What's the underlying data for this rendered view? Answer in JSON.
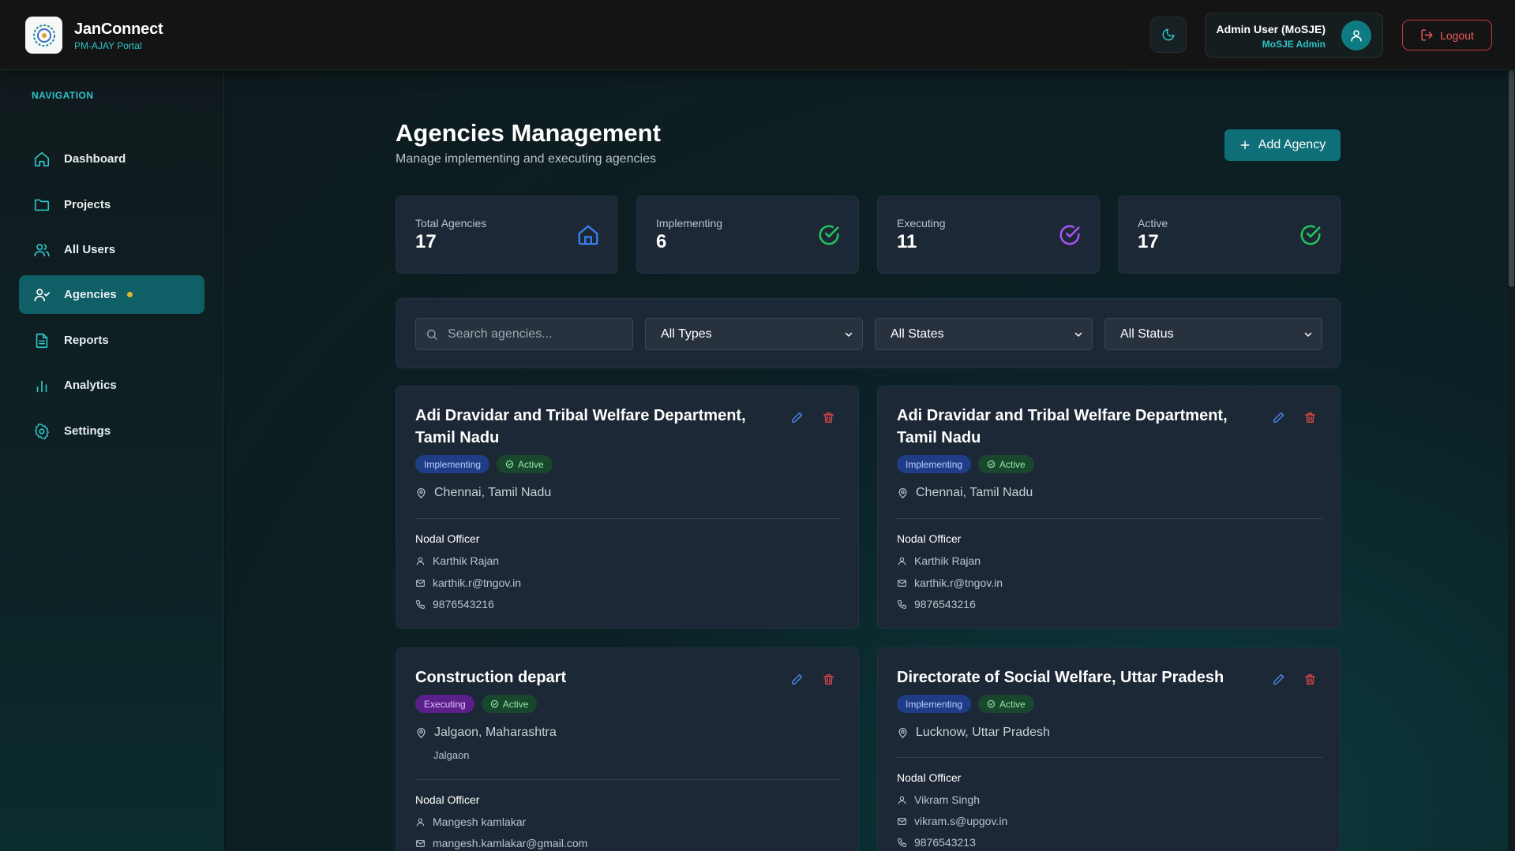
{
  "header": {
    "app_name": "JanConnect",
    "app_sub": "PM-AJAY Portal",
    "user_name": "Admin User (MoSJE)",
    "user_role": "MoSJE Admin",
    "logout_label": "Logout"
  },
  "sidebar": {
    "title": "NAVIGATION",
    "items": [
      {
        "label": "Dashboard",
        "icon": "home-icon"
      },
      {
        "label": "Projects",
        "icon": "folder-icon"
      },
      {
        "label": "All Users",
        "icon": "users-icon"
      },
      {
        "label": "Agencies",
        "icon": "user-check-icon",
        "active": true
      },
      {
        "label": "Reports",
        "icon": "file-text-icon"
      },
      {
        "label": "Analytics",
        "icon": "bar-chart-icon"
      },
      {
        "label": "Settings",
        "icon": "gear-icon"
      }
    ]
  },
  "main": {
    "title": "Agencies Management",
    "subtitle": "Manage implementing and executing agencies",
    "add_label": "Add Agency",
    "stats": [
      {
        "label": "Total Agencies",
        "value": "17",
        "color": "#3b82f6"
      },
      {
        "label": "Implementing",
        "value": "6",
        "color": "#22c55e"
      },
      {
        "label": "Executing",
        "value": "11",
        "color": "#a855f7"
      },
      {
        "label": "Active",
        "value": "17",
        "color": "#22c55e"
      }
    ],
    "filters": {
      "search_placeholder": "Search agencies...",
      "type": "All Types",
      "state": "All States",
      "status": "All Status"
    },
    "agencies": [
      {
        "name": "Adi Dravidar and Tribal Welfare Department, Tamil Nadu",
        "type": "Implementing",
        "status": "Active",
        "location": "Chennai, Tamil Nadu",
        "officer_label": "Nodal Officer",
        "officer_name": "Karthik Rajan",
        "officer_email": "karthik.r@tngov.in",
        "officer_phone": "9876543216"
      },
      {
        "name": "Adi Dravidar and Tribal Welfare Department, Tamil Nadu",
        "type": "Implementing",
        "status": "Active",
        "location": "Chennai, Tamil Nadu",
        "officer_label": "Nodal Officer",
        "officer_name": "Karthik Rajan",
        "officer_email": "karthik.r@tngov.in",
        "officer_phone": "9876543216"
      },
      {
        "name": "Construction depart",
        "type": "Executing",
        "status": "Active",
        "location": "Jalgaon, Maharashtra",
        "location_sub": "Jalgaon",
        "officer_label": "Nodal Officer",
        "officer_name": "Mangesh kamlakar",
        "officer_email": "mangesh.kamlakar@gmail.com"
      },
      {
        "name": "Directorate of Social Welfare, Uttar Pradesh",
        "type": "Implementing",
        "status": "Active",
        "location": "Lucknow, Uttar Pradesh",
        "officer_label": "Nodal Officer",
        "officer_name": "Vikram Singh",
        "officer_email": "vikram.s@upgov.in",
        "officer_phone": "9876543213"
      }
    ]
  }
}
